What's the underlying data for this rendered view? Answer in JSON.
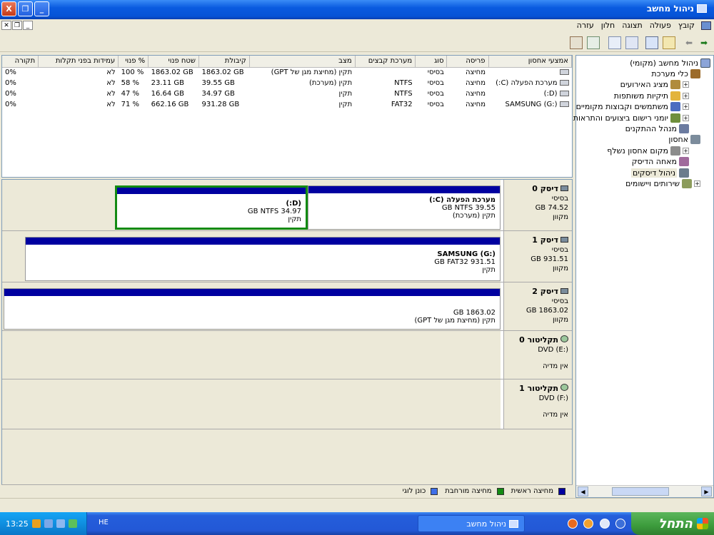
{
  "window": {
    "title": "ניהול מחשב",
    "close_label": "X",
    "restore_label": "❐",
    "min_label": "_"
  },
  "menubar": {
    "items": [
      "קובץ",
      "פעולה",
      "תצוגה",
      "חלון",
      "עזרה"
    ],
    "mdi_close": "✕",
    "mdi_restore": "❐",
    "mdi_min": "_"
  },
  "toolbar": {
    "back_icon": "arrow-left-icon",
    "forward_icon": "arrow-right-icon"
  },
  "tree": {
    "root": "ניהול מחשב (מקומי)",
    "items": [
      {
        "label": "כלי מערכת",
        "indent": 0,
        "expander": "",
        "color": "#9C6B2A"
      },
      {
        "label": "מציג האירועים",
        "indent": 1,
        "expander": "+",
        "color": "#B08C3C"
      },
      {
        "label": "תיקיות משותפות",
        "indent": 1,
        "expander": "+",
        "color": "#E3B43C"
      },
      {
        "label": "משתמשים וקבוצות מקומיים",
        "indent": 1,
        "expander": "+",
        "color": "#4B6CC0"
      },
      {
        "label": "יומני רישום ביצועים והתראות",
        "indent": 1,
        "expander": "+",
        "color": "#6F8F3C"
      },
      {
        "label": "מנהל ההתקנים",
        "indent": 1,
        "expander": "",
        "color": "#6B7BA0"
      },
      {
        "label": "אחסון",
        "indent": 0,
        "expander": "",
        "color": "#7C8C9C"
      },
      {
        "label": "מקום אחסון נשלף",
        "indent": 1,
        "expander": "+",
        "color": "#8C8C8C"
      },
      {
        "label": "מאחה הדיסק",
        "indent": 1,
        "expander": "",
        "color": "#A06A9C"
      },
      {
        "label": "ניהול דיסקים",
        "indent": 1,
        "expander": "",
        "color": "#6C7C8C",
        "selected": true
      },
      {
        "label": "שירותים ויישומים",
        "indent": 0,
        "expander": "+",
        "color": "#8C9C5C"
      }
    ]
  },
  "volumes": {
    "headers": [
      "אמצעי אחסון",
      "פריסה",
      "סוג",
      "מערכת קבצים",
      "מצב",
      "קיבולת",
      "שטח פנוי",
      "% פנוי",
      "עמידות בפני תקלות",
      "תקורה"
    ],
    "rows": [
      [
        "",
        "מחיצה",
        "בסיסי",
        "",
        "תקין (מחיצת מגן של GPT)",
        "1863.02 GB",
        "1863.02 GB",
        "100 %",
        "לא",
        "0%"
      ],
      [
        "מערכת הפעלה (C:)",
        "מחיצה",
        "בסיסי",
        "NTFS",
        "תקין (מערכת)",
        "39.55 GB",
        "23.11 GB",
        "58 %",
        "לא",
        "0%"
      ],
      [
        "(D:)",
        "מחיצה",
        "בסיסי",
        "NTFS",
        "תקין",
        "34.97 GB",
        "16.64 GB",
        "47 %",
        "לא",
        "0%"
      ],
      [
        "SAMSUNG (G:)",
        "מחיצה",
        "בסיסי",
        "FAT32",
        "תקין",
        "931.28 GB",
        "662.16 GB",
        "71 %",
        "לא",
        "0%"
      ]
    ]
  },
  "disks": [
    {
      "name": "דיסק 0",
      "type": "בסיסי",
      "size": "74.52 GB",
      "status": "מקוון",
      "partitions": [
        {
          "name": "מערכת הפעלה (C:)",
          "detail": "39.55 GB NTFS",
          "status": "תקין (מערכת)"
        },
        {
          "name": "(D:)",
          "detail": "34.97 GB NTFS",
          "status": "תקין"
        }
      ]
    },
    {
      "name": "דיסק 1",
      "type": "בסיסי",
      "size": "931.51 GB",
      "status": "מקוון",
      "partitions": [
        {
          "name": "SAMSUNG (G:)",
          "detail": "931.51 GB FAT32",
          "status": "תקין"
        }
      ]
    },
    {
      "name": "דיסק 2",
      "type": "בסיסי",
      "size": "1863.02 GB",
      "status": "מקוון",
      "partitions": [
        {
          "name": "",
          "detail": "1863.02 GB",
          "status": "תקין (מחיצת מגן של GPT)"
        }
      ]
    }
  ],
  "cdroms": [
    {
      "name": "תקליטור 0",
      "drive": "DVD (E:)",
      "status": "אין מדיה"
    },
    {
      "name": "תקליטור 1",
      "drive": "DVD (F:)",
      "status": "אין מדיה"
    }
  ],
  "legend": [
    {
      "label": "מחיצה ראשית",
      "color": "#0000A0"
    },
    {
      "label": "מחיצה מורחבת",
      "color": "#138B13"
    },
    {
      "label": "כונן לוגי",
      "color": "#3F6FE8"
    }
  ],
  "taskbar": {
    "start_label": "התחל",
    "task_label": "ניהול מחשב",
    "clock": "13:25",
    "lang": "HE"
  }
}
